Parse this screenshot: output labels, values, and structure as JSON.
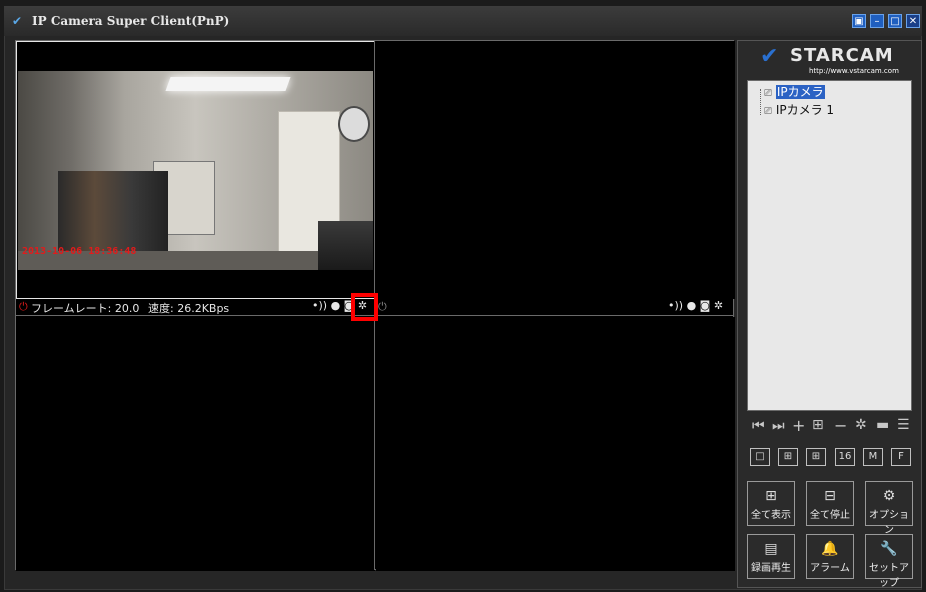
{
  "window": {
    "title": "IP Camera Super Client(PnP)"
  },
  "video": {
    "timestamp": "2013-10-06 18:36:48"
  },
  "pane1": {
    "frame_rate": "フレームレート: 20.0",
    "speed": "速度: 26.2KBps",
    "tool_glyphs": "•)) ● ◙ ✲"
  },
  "pane2": {
    "tool_glyphs": "•)) ● ◙ ✲"
  },
  "brand": {
    "name": "STARCAM",
    "url": "http://www.vstarcam.com"
  },
  "tree": {
    "items": [
      {
        "label": "IPカメラ"
      },
      {
        "label": "IPカメラ 1"
      }
    ]
  },
  "toolbar": {
    "icons": [
      "skip-start-icon",
      "skip-end-icon",
      "add-icon",
      "add-group-icon",
      "remove-icon",
      "settings-icon",
      "panel-icon",
      "list-icon"
    ]
  },
  "layouts": {
    "labels": [
      "□",
      "⊞",
      "⊞",
      "16",
      "M",
      "F"
    ]
  },
  "buttons": {
    "show_all": "全て表示",
    "stop_all": "全て停止",
    "options": "オプション",
    "playback": "録画再生",
    "alarm": "アラーム",
    "setup": "セットアップ"
  },
  "colors": {
    "accent": "#2b62c4",
    "timestamp": "#e21b1b",
    "highlight": "#ff0000"
  }
}
